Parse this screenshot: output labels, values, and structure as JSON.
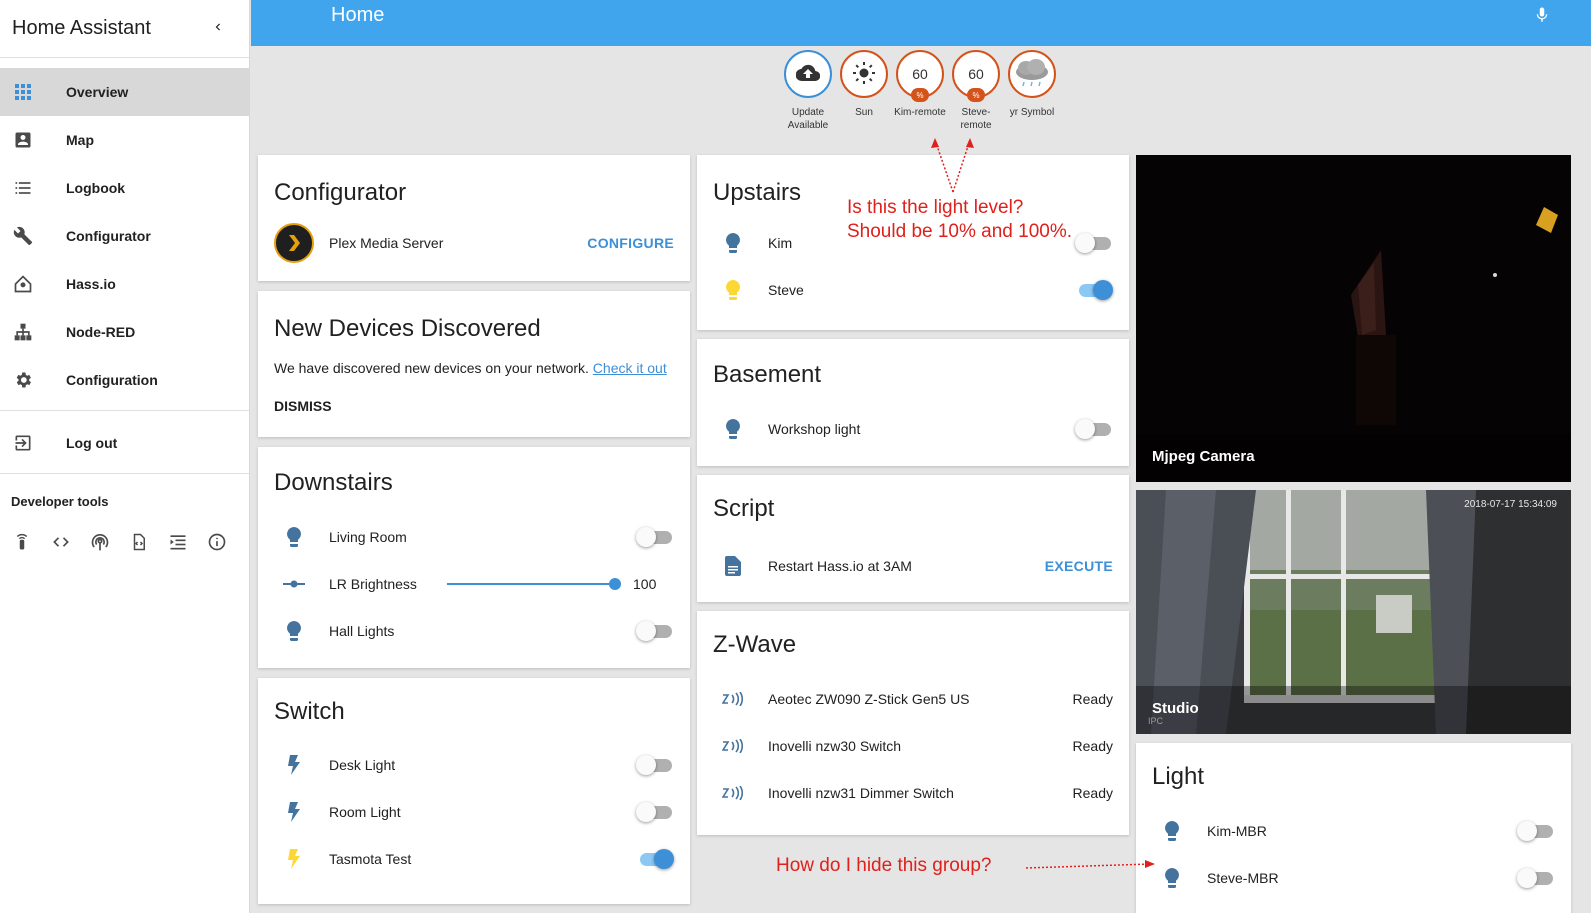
{
  "sidebar": {
    "title": "Home Assistant",
    "items": [
      {
        "label": "Overview",
        "icon": "grid-icon"
      },
      {
        "label": "Map",
        "icon": "account-box-icon"
      },
      {
        "label": "Logbook",
        "icon": "format-list-icon"
      },
      {
        "label": "Configurator",
        "icon": "wrench-icon"
      },
      {
        "label": "Hass.io",
        "icon": "home-assistant-icon"
      },
      {
        "label": "Node-RED",
        "icon": "sitemap-icon"
      },
      {
        "label": "Configuration",
        "icon": "settings-icon"
      },
      {
        "label": "Log out",
        "icon": "exit-icon"
      }
    ],
    "dev_tools_title": "Developer tools"
  },
  "header": {
    "title": "Home"
  },
  "badges": [
    {
      "value": "",
      "label": "Update Available",
      "icon": "cloud-upload-icon"
    },
    {
      "value": "",
      "label": "Sun",
      "icon": "sun-icon"
    },
    {
      "value": "60",
      "unit": "%",
      "label": "Kim-remote"
    },
    {
      "value": "60",
      "unit": "%",
      "label": "Steve-remote"
    },
    {
      "value": "",
      "label": "yr Symbol",
      "icon": "cloud-rain-icon"
    }
  ],
  "configurator": {
    "title": "Configurator",
    "item": "Plex Media Server",
    "action": "CONFIGURE"
  },
  "discovery": {
    "title": "New Devices Discovered",
    "text": "We have discovered new devices on your network.",
    "link": "Check it out",
    "dismiss": "DISMISS"
  },
  "downstairs": {
    "title": "Downstairs",
    "rows": [
      {
        "label": "Living Room",
        "state": "off"
      },
      {
        "label": "LR Brightness",
        "value": "100"
      },
      {
        "label": "Hall Lights",
        "state": "off"
      }
    ]
  },
  "switch": {
    "title": "Switch",
    "rows": [
      {
        "label": "Desk Light",
        "state": "off"
      },
      {
        "label": "Room Light",
        "state": "off"
      },
      {
        "label": "Tasmota Test",
        "state": "on"
      }
    ]
  },
  "upstairs": {
    "title": "Upstairs",
    "rows": [
      {
        "label": "Kim",
        "state": "off"
      },
      {
        "label": "Steve",
        "state": "on"
      }
    ]
  },
  "basement": {
    "title": "Basement",
    "rows": [
      {
        "label": "Workshop light",
        "state": "off"
      }
    ]
  },
  "script": {
    "title": "Script",
    "item": "Restart Hass.io at 3AM",
    "action": "EXECUTE"
  },
  "zwave": {
    "title": "Z-Wave",
    "rows": [
      {
        "label": "Aeotec ZW090 Z-Stick Gen5 US",
        "state": "Ready"
      },
      {
        "label": "Inovelli nzw30 Switch",
        "state": "Ready"
      },
      {
        "label": "Inovelli nzw31 Dimmer Switch",
        "state": "Ready"
      }
    ]
  },
  "cameras": [
    {
      "caption": "Mjpeg Camera"
    },
    {
      "caption": "Studio",
      "timestamp": "2018-07-17 15:34:09",
      "watermark": "IPC"
    }
  ],
  "light": {
    "title": "Light",
    "rows": [
      {
        "label": "Kim-MBR",
        "state": "off"
      },
      {
        "label": "Steve-MBR",
        "state": "off"
      }
    ]
  },
  "annotations": {
    "light_level_1": "Is this the light level?",
    "light_level_2": "Should be 10% and 100%.",
    "hide_group": "How do I hide this group?"
  },
  "colors": {
    "accent": "#41a5ee",
    "badge_border": "#d4531b",
    "icon": "#44739e",
    "icon_on": "#fdd835",
    "annotation": "#e0201b"
  }
}
